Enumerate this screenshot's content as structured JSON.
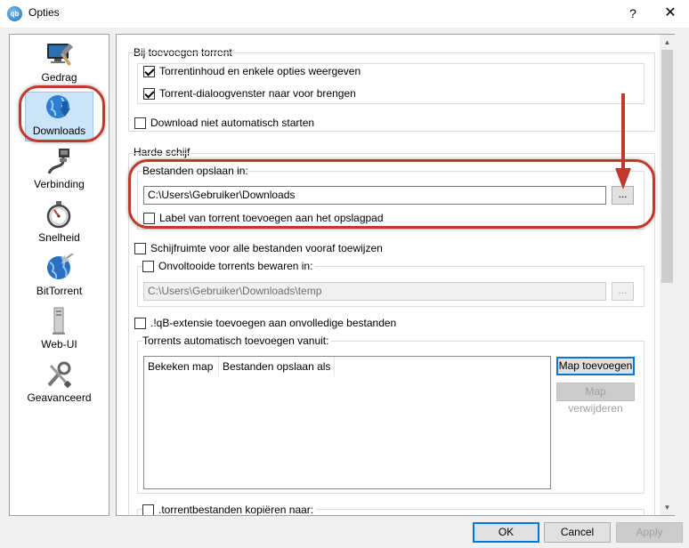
{
  "window": {
    "title": "Opties",
    "app_icon": "qBittorrent-logo-icon",
    "help": "?",
    "close": "✕"
  },
  "sidebar": {
    "items": [
      {
        "label": "Gedrag",
        "icon": "monitor-icon"
      },
      {
        "label": "Downloads",
        "icon": "globe-download-icon",
        "selected": true
      },
      {
        "label": "Verbinding",
        "icon": "network-cable-icon"
      },
      {
        "label": "Snelheid",
        "icon": "stopwatch-icon"
      },
      {
        "label": "BitTorrent",
        "icon": "bittorrent-globe-icon"
      },
      {
        "label": "Web-UI",
        "icon": "server-tower-icon"
      },
      {
        "label": "Geavanceerd",
        "icon": "tools-icon"
      }
    ]
  },
  "downloads": {
    "add_torrent_title": "Bij toevoegen torrent",
    "show_dialog": {
      "label": "Torrentinhoud en enkele opties weergeven",
      "checked": true
    },
    "bring_to_front": {
      "label": "Torrent-dialoogvenster naar voor brengen",
      "checked": true
    },
    "no_auto_start": {
      "label": "Download niet automatisch starten",
      "checked": false
    },
    "hard_disk_title": "Harde schijf",
    "save_path_label": "Bestanden opslaan in:",
    "save_path_value": "C:\\Users\\Gebruiker\\Downloads",
    "browse_label": "...",
    "append_label": {
      "label": "Label van torrent toevoegen aan het opslagpad",
      "checked": false
    },
    "preallocate": {
      "label": "Schijfruimte voor alle bestanden vooraf toewijzen",
      "checked": false
    },
    "temp_folder": {
      "label": "Onvoltooide torrents bewaren in:",
      "checked": false
    },
    "temp_path_value": "C:\\Users\\Gebruiker\\Downloads\\temp",
    "iqb_extension": {
      "label": ".!qB-extensie toevoegen aan onvolledige bestanden",
      "checked": false
    },
    "auto_add_title": "Torrents automatisch toevoegen vanuit:",
    "table_headers": [
      "Bekeken map",
      "Bestanden opslaan als"
    ],
    "add_folder_button": "Map toevoegen",
    "remove_folder_button": "Map verwijderen",
    "copy_torrent": {
      "label": ".torrentbestanden kopiëren naar:",
      "checked": false
    }
  },
  "footer": {
    "ok": "OK",
    "cancel": "Cancel",
    "apply": "Apply"
  },
  "colors": {
    "annotation": "#c0392b",
    "selection": "#cce4f7",
    "focus": "#0078d7"
  }
}
